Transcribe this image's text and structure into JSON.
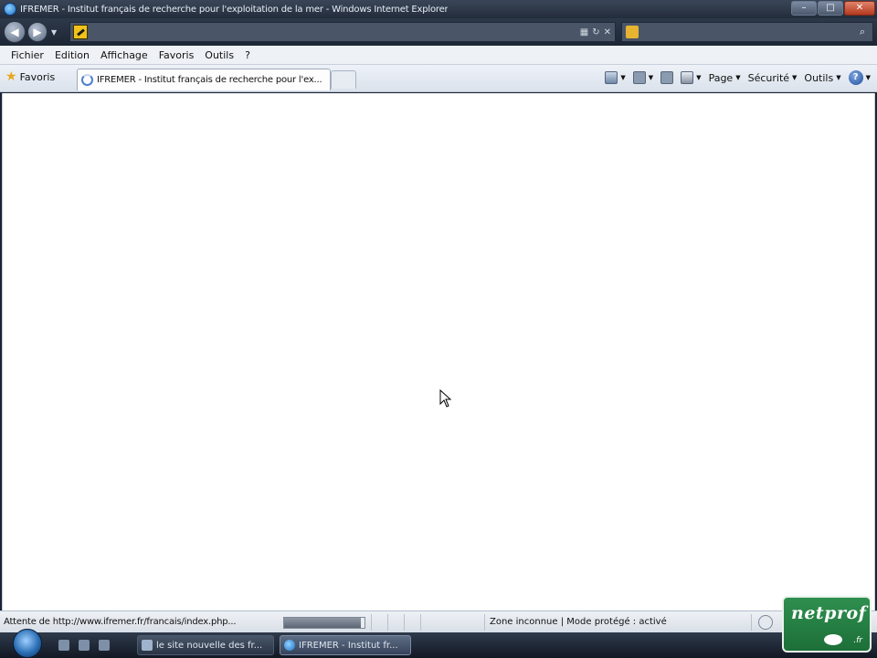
{
  "window": {
    "title": "IFREMER - Institut français de recherche pour l'exploitation de la mer - Windows Internet Explorer",
    "controls": [
      "–",
      "□",
      "✕"
    ]
  },
  "address_bar": {
    "url": "",
    "search_placeholder": ""
  },
  "menu": {
    "items": [
      "Fichier",
      "Edition",
      "Affichage",
      "Favoris",
      "Outils",
      "?"
    ]
  },
  "favorites_bar": {
    "favorites_label": "Favoris",
    "tab_title": "IFREMER - Institut français de recherche pour l'ex...",
    "commands": [
      "Page",
      "Sécurité",
      "Outils"
    ]
  },
  "status_bar": {
    "text": "Attente de http://www.ifremer.fr/francais/index.php...",
    "progress": 0.95,
    "zone": "Zone inconnue | Mode protégé : activé"
  },
  "taskbar": {
    "items": [
      {
        "label": "le site nouvelle des fr..."
      },
      {
        "label": "IFREMER - Institut fr..."
      }
    ]
  },
  "watermark": {
    "word": "netprof",
    "suffix": ".fr"
  },
  "colors": {
    "chrome_dark": "#232c3b",
    "menu_bg": "#eef1f6",
    "logo_green": "#2f8f4f"
  }
}
